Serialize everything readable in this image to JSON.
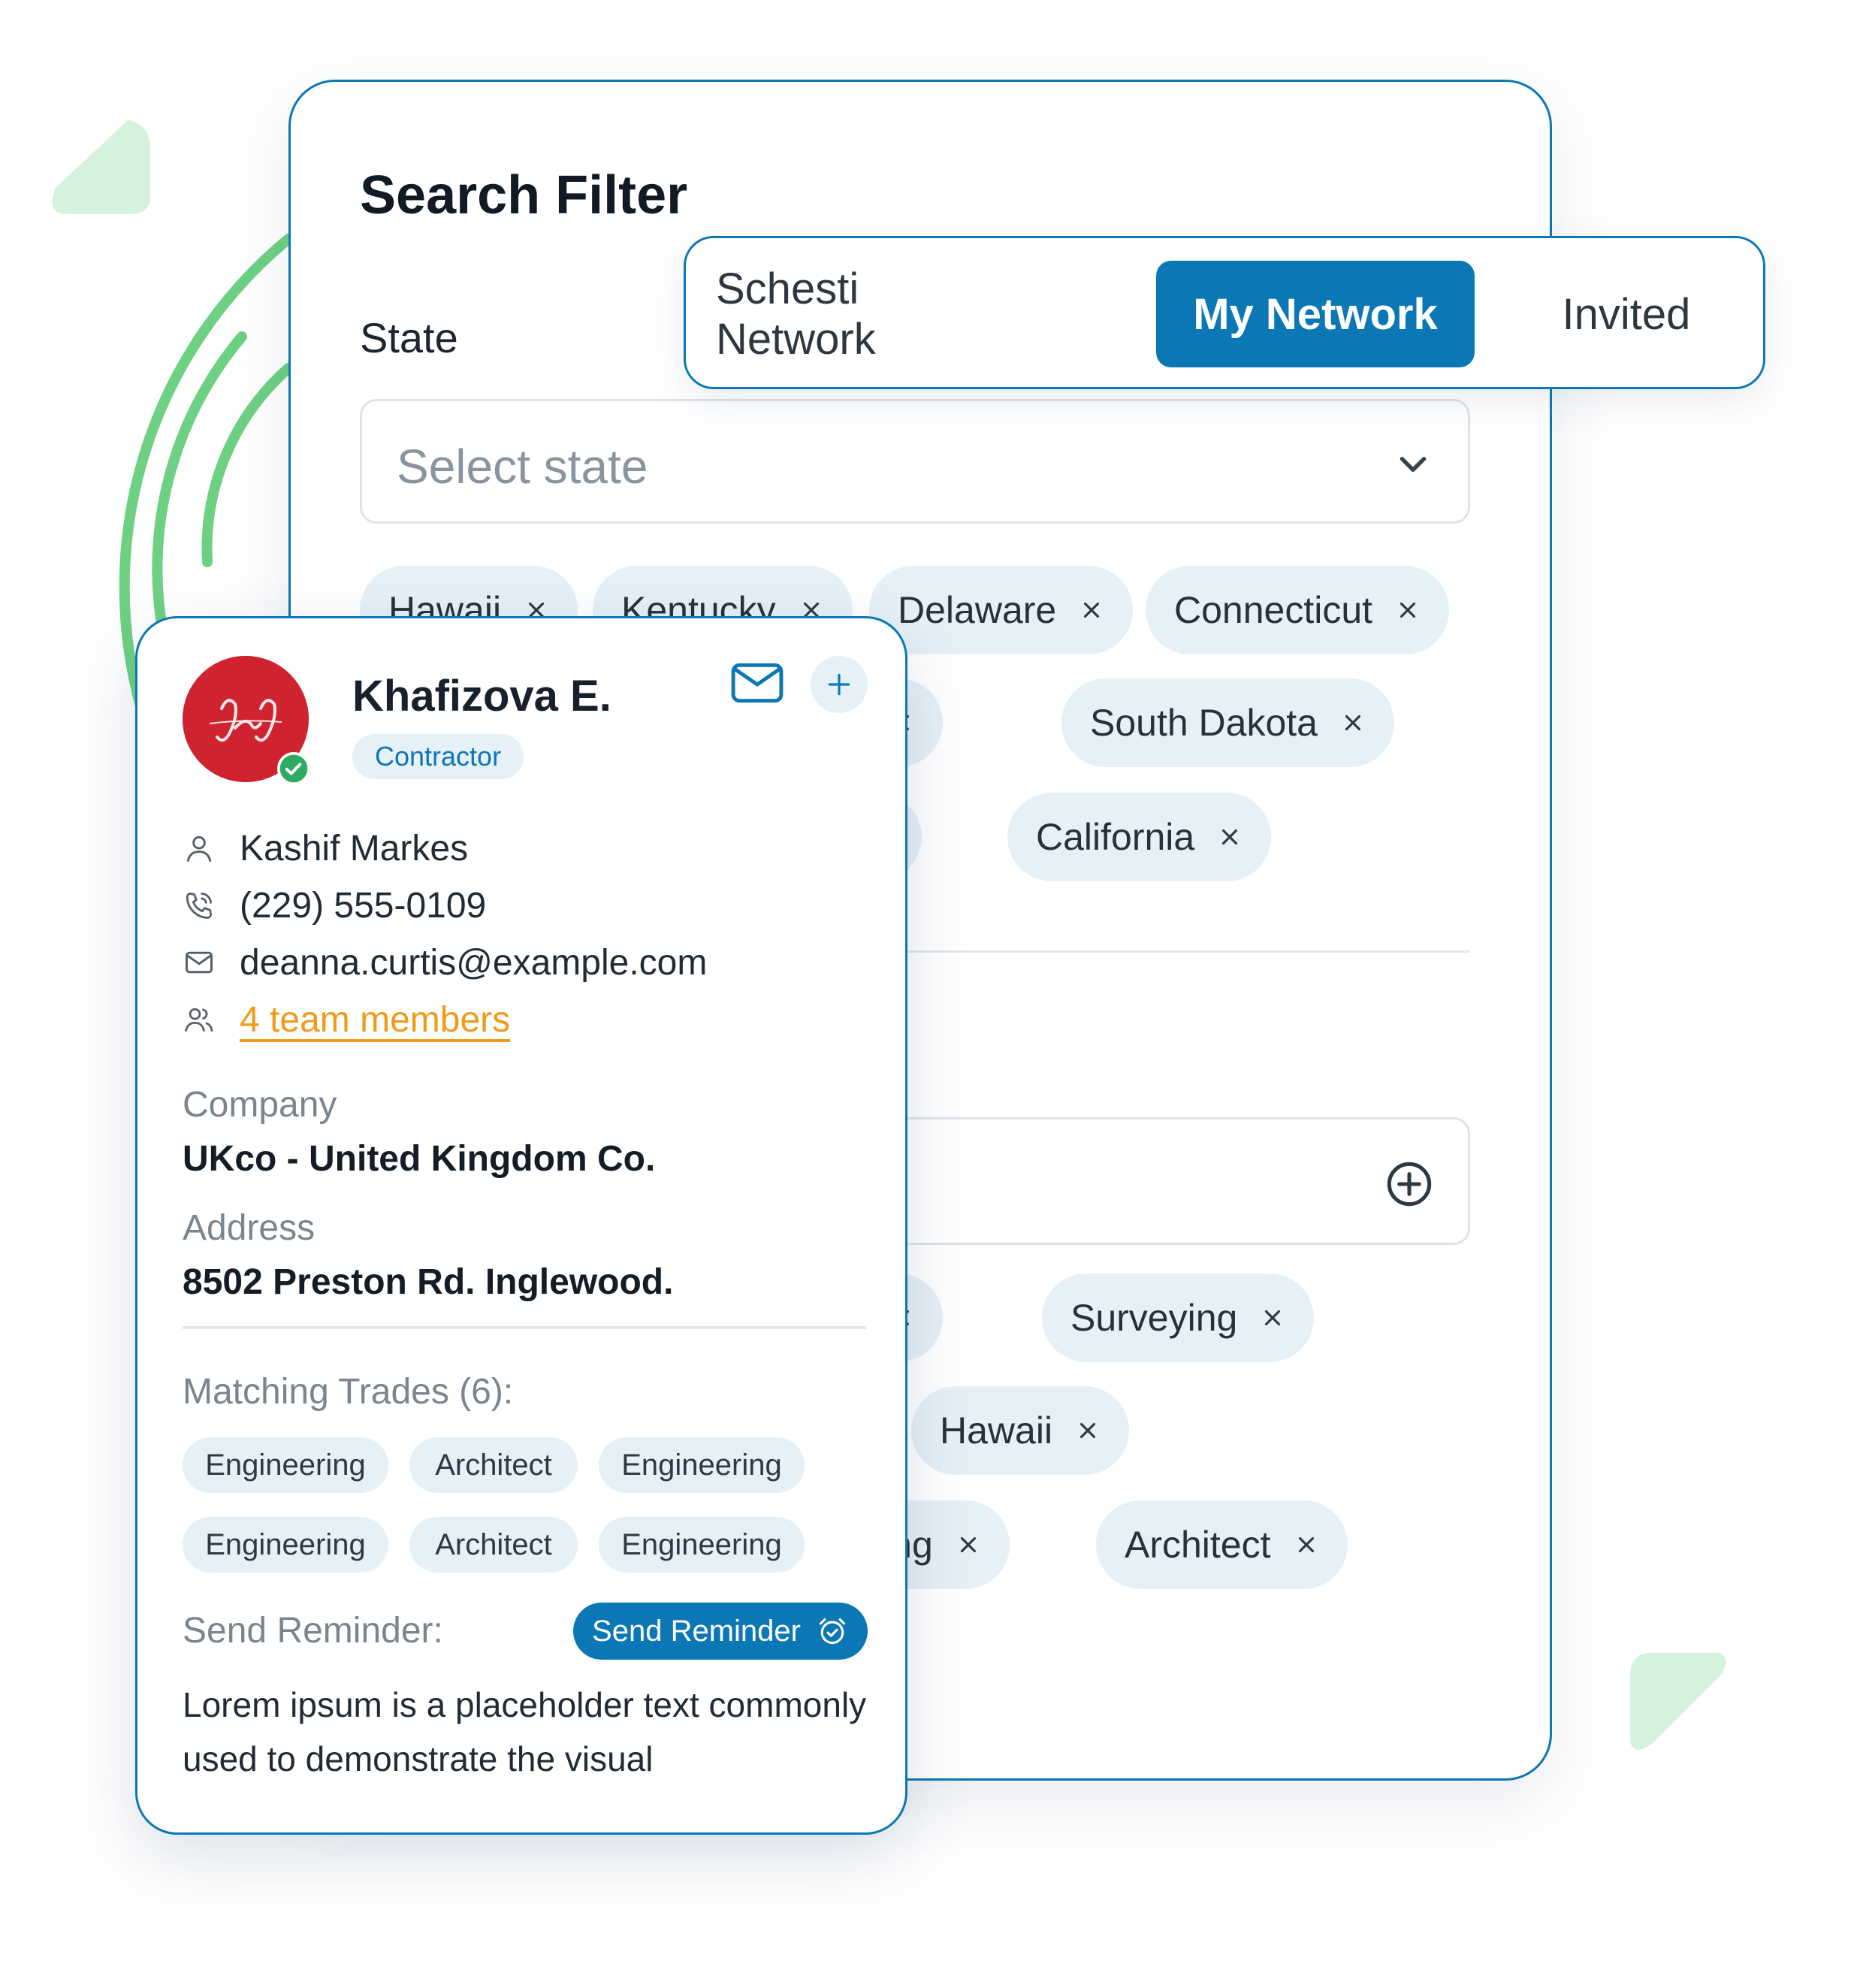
{
  "colors": {
    "accent": "#0b78b5",
    "chip_bg": "#e6f0f7",
    "deco_green": "#6dd083",
    "deco_green_light": "#d4f2dc",
    "link_orange": "#f09a1a",
    "avatar_red": "#cf2330"
  },
  "filter": {
    "title": "Search Filter",
    "state_label": "State",
    "state_placeholder": "Select state",
    "state_chips": [
      "Hawaii",
      "Kentucky",
      "Delaware",
      "Connecticut",
      "o",
      "South Dakota",
      "",
      "California"
    ],
    "trade_chips": [
      "g",
      "Surveying",
      "Hawaii",
      "ailing",
      "Architect"
    ],
    "chip_remove_icon": "close-icon",
    "select_icon": "chevron-down-icon",
    "add_icon": "plus-circle-icon"
  },
  "tabs": [
    {
      "label": "Schesti Network",
      "active": false
    },
    {
      "label": "My Network",
      "active": true
    },
    {
      "label": "Invited",
      "active": false
    }
  ],
  "card": {
    "name": "Khafizova E.",
    "role": "Contractor",
    "contact_person": "Kashif Markes",
    "phone": "(229) 555-0109",
    "email": "deanna.curtis@example.com",
    "team_link": "4 team members",
    "company_label": "Company",
    "company_value": "UKco - United Kingdom Co.",
    "address_label": "Address",
    "address_value": "8502 Preston Rd. Inglewood.",
    "matching_trades_label": "Matching Trades (6):",
    "trades": [
      "Engineering",
      "Architect",
      "Engineering",
      "Engineering",
      "Architect",
      "Engineering"
    ],
    "reminder_label": "Send Reminder:",
    "reminder_button": "Send Reminder",
    "description": " Lorem ipsum is a placeholder text commonly used to demonstrate the visual",
    "icons": [
      "user-icon",
      "phone-icon",
      "mail-icon",
      "team-icon",
      "alarm-clock-icon",
      "verified-icon"
    ]
  }
}
